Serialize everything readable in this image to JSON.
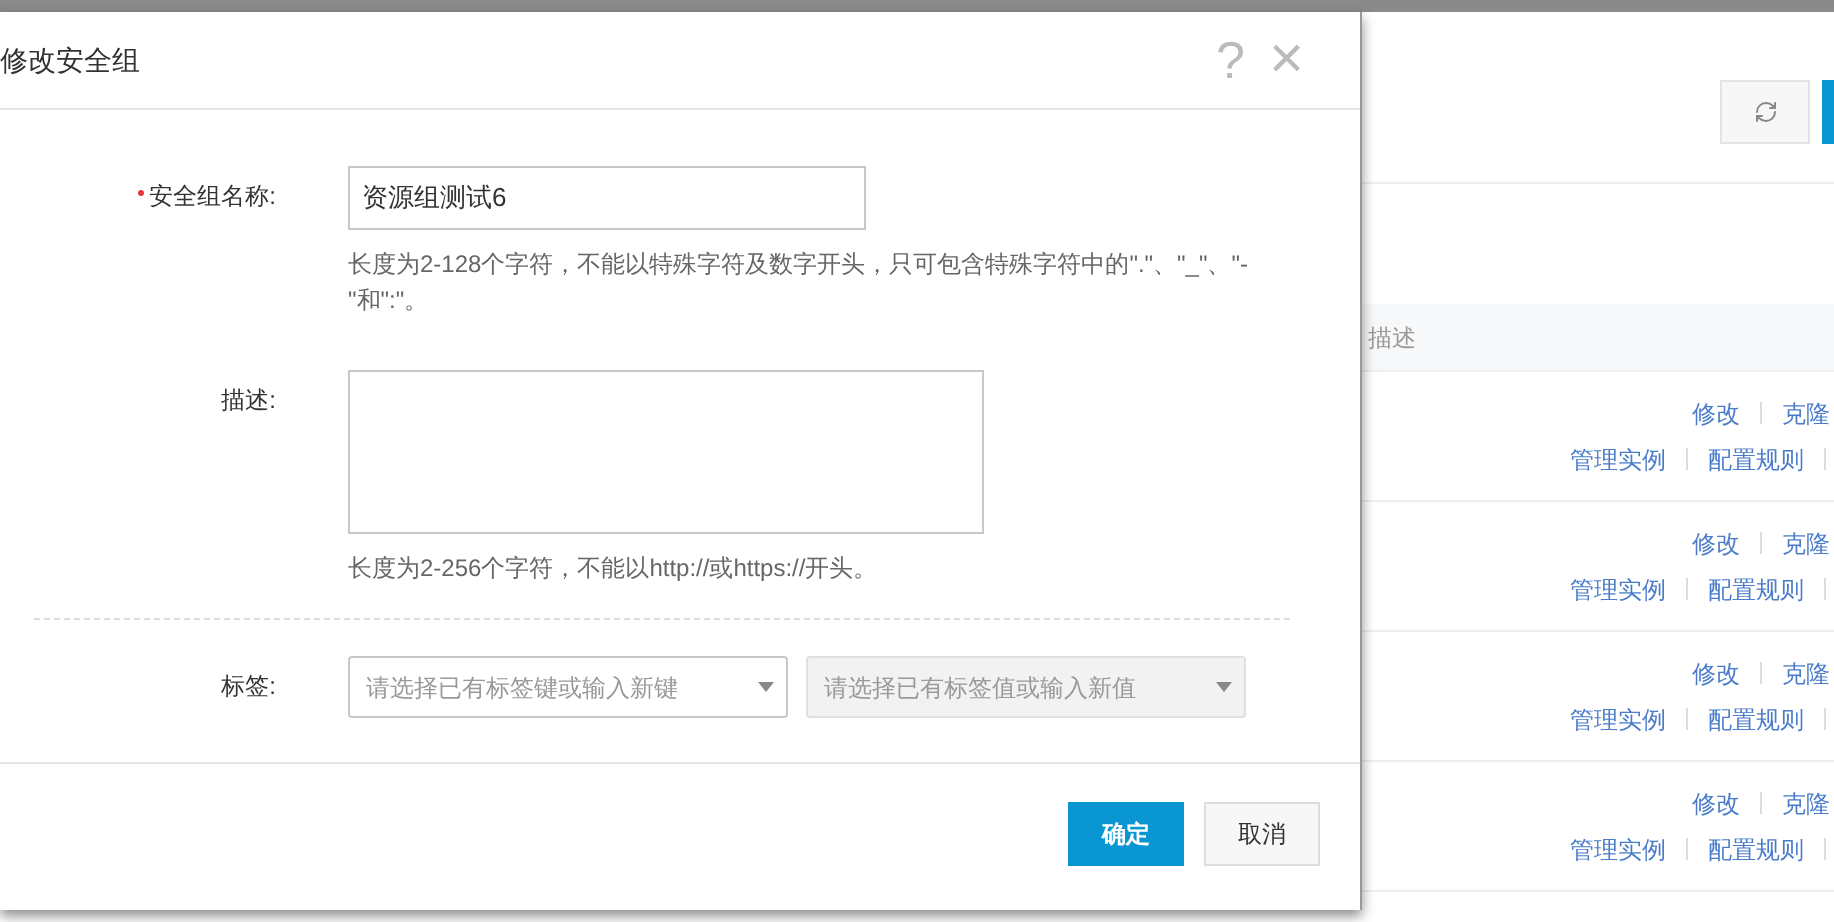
{
  "background": {
    "table": {
      "columns": [
        {
          "label": "描述"
        }
      ],
      "rows": [
        {
          "actions": [
            [
              "修改",
              "克隆"
            ],
            [
              "管理实例",
              "配置规则"
            ]
          ]
        },
        {
          "actions": [
            [
              "修改",
              "克隆"
            ],
            [
              "管理实例",
              "配置规则"
            ]
          ]
        },
        {
          "actions": [
            [
              "修改",
              "克隆"
            ],
            [
              "管理实例",
              "配置规则"
            ]
          ]
        },
        {
          "actions": [
            [
              "修改",
              "克隆"
            ],
            [
              "管理实例",
              "配置规则"
            ]
          ]
        }
      ]
    }
  },
  "dialog": {
    "title": "修改安全组",
    "help": "?",
    "close": "×",
    "fields": [
      {
        "kind": "input",
        "label": "安全组名称:",
        "required": true,
        "value": "资源组测试6",
        "hint": "长度为2-128个字符，不能以特殊字符及数字开头，只可包含特殊字符中的\".\"、\"_\"、\"-\"和\":\"。"
      },
      {
        "kind": "textarea",
        "label": "描述:",
        "required": false,
        "hint": "长度为2-256个字符，不能以http://或https://开头。"
      },
      {
        "kind": "selects",
        "label": "标签:",
        "required": false,
        "selects": [
          {
            "placeholder": "请选择已有标签键或输入新键",
            "disabled": false
          },
          {
            "placeholder": "请选择已有标签值或输入新值",
            "disabled": true
          }
        ]
      }
    ],
    "buttons": [
      {
        "label": "确定",
        "kind": "primary"
      },
      {
        "label": "取消",
        "kind": "secondary"
      }
    ]
  }
}
